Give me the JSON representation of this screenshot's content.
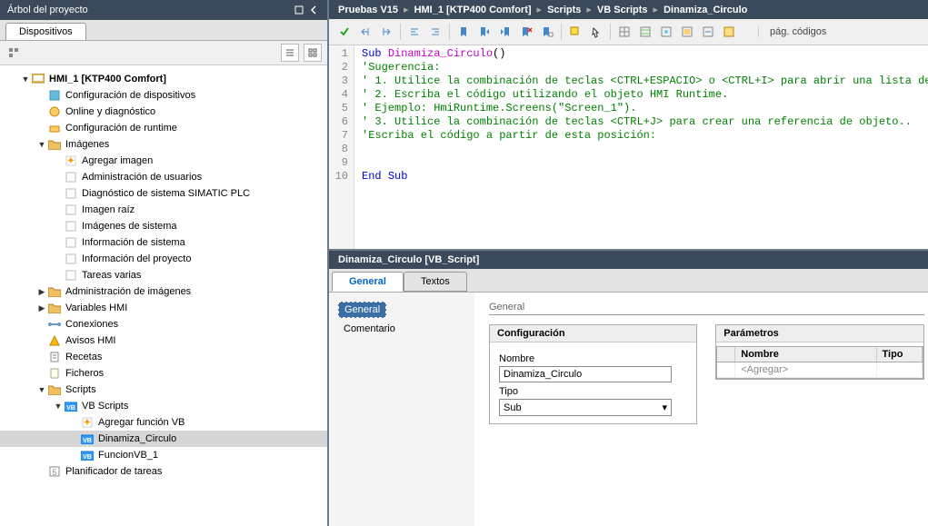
{
  "left": {
    "title": "Árbol del proyecto",
    "tab": "Dispositivos"
  },
  "tree": {
    "n0": "HMI_1 [KTP400 Comfort]",
    "n1": "Configuración de dispositivos",
    "n2": "Online y diagnóstico",
    "n3": "Configuración de runtime",
    "n4": "Imágenes",
    "n5": "Agregar imagen",
    "n6": "Administración de usuarios",
    "n7": "Diagnóstico de sistema SIMATIC PLC",
    "n8": "Imagen raíz",
    "n9": "Imágenes de sistema",
    "n10": "Información de sistema",
    "n11": "Información del proyecto",
    "n12": "Tareas varias",
    "n13": "Administración de imágenes",
    "n14": "Variables HMI",
    "n15": "Conexiones",
    "n16": "Avisos HMI",
    "n17": "Recetas",
    "n18": "Ficheros",
    "n19": "Scripts",
    "n20": "VB Scripts",
    "n21": "Agregar función VB",
    "n22": "Dinamiza_Circulo",
    "n23": "FuncionVB_1",
    "n24": "Planificador de tareas"
  },
  "breadcrumb": [
    "Pruebas V15",
    "HMI_1 [KTP400 Comfort]",
    "Scripts",
    "VB Scripts",
    "Dinamiza_Circulo"
  ],
  "toolbar": {
    "pageLabel": "pág. códigos"
  },
  "code": {
    "l1a": "Sub",
    "l1b": "Dinamiza_Circulo",
    "l1c": "()",
    "l2": "'Sugerencia:",
    "l3": "' 1. Utilice la combinación de teclas <CTRL+ESPACIO> o <CTRL+I> para abrir una lista de",
    "l4": "' 2. Escriba el código utilizando el objeto HMI Runtime.",
    "l5": "'  Ejemplo: HmiRuntime.Screens(\"Screen_1\").",
    "l6": "' 3. Utilice la combinación de teclas <CTRL+J> para crear una referencia de objeto..",
    "l7": "'Escriba el código a partir de esta posición:",
    "l10a": "End",
    "l10b": "Sub"
  },
  "props": {
    "header": "Dinamiza_Circulo [VB_Script]",
    "tabs": {
      "general": "General",
      "textos": "Textos"
    },
    "sidebar": {
      "general": "General",
      "comentario": "Comentario"
    },
    "groupTitle": "General",
    "config": {
      "title": "Configuración",
      "nameLabel": "Nombre",
      "nameValue": "Dinamiza_Circulo",
      "tipoLabel": "Tipo",
      "tipoValue": "Sub"
    },
    "params": {
      "title": "Parámetros",
      "colName": "Nombre",
      "colType": "Tipo",
      "addRow": "<Agregar>"
    }
  }
}
